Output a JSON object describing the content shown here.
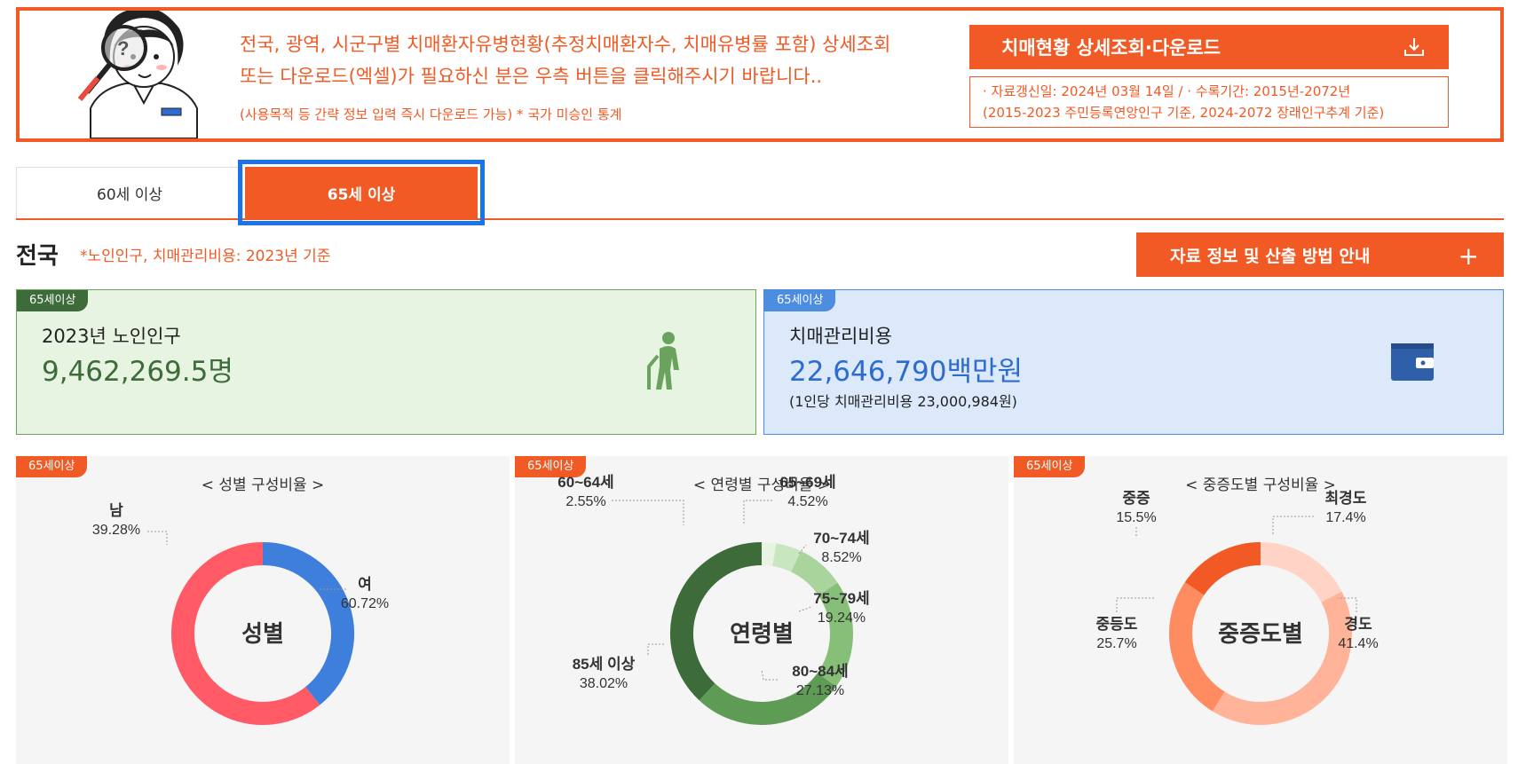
{
  "banner": {
    "line1": "전국, 광역, 시군구별 치매환자유병현황(추정치매환자수, 치매유병률 포함) 상세조회",
    "line2": "또는 다운로드(엑셀)가 필요하신 분은 우측 버튼을 클릭해주시기 바랍니다..",
    "sub": "(사용목적 등 간략 정보 입력 즉시 다운로드 가능) * 국가 미승인 통계",
    "download_label": "치매현황 상세조회·다운로드",
    "update_line1": "· 자료갱신일: 2024년 03월 14일 / · 수록기간: 2015년-2072년",
    "update_line2": "(2015-2023 주민등록연앙인구 기준, 2024-2072 장래인구추계 기준)"
  },
  "tabs": [
    {
      "label": "60세 이상",
      "active": false
    },
    {
      "label": "65세 이상",
      "active": true
    }
  ],
  "region": {
    "name": "전국",
    "note": "*노인인구, 치매관리비용: 2023년 기준",
    "info_button": "자료 정보 및 산출 방법 안내"
  },
  "cards": {
    "population": {
      "tag": "65세이상",
      "label": "2023년 노인인구",
      "value": "9,462,269.5명",
      "icon": "elderly-person-icon",
      "color": "#3d6b3a"
    },
    "cost": {
      "tag": "65세이상",
      "label": "치매관리비용",
      "value": "22,646,790백만원",
      "sub": "(1인당 치매관리비용 23,000,984원)",
      "icon": "wallet-icon",
      "color": "#2e6bd1"
    }
  },
  "panels": [
    {
      "tag": "65세이상",
      "title": "< 성별 구성비율 >",
      "center": "성별",
      "segments": [
        {
          "label": "남",
          "value": "39.28%",
          "pct": 39.28,
          "color": "#3f7fdc"
        },
        {
          "label": "여",
          "value": "60.72%",
          "pct": 60.72,
          "color": "#ff5a66"
        }
      ]
    },
    {
      "tag": "65세이상",
      "title": "< 연령별 구성비율 >",
      "center": "연령별",
      "segments": [
        {
          "label": "60~64세",
          "value": "2.55%",
          "pct": 2.55,
          "color": "#e6f4e1"
        },
        {
          "label": "65~69세",
          "value": "4.52%",
          "pct": 4.52,
          "color": "#c8e6bf"
        },
        {
          "label": "70~74세",
          "value": "8.52%",
          "pct": 8.52,
          "color": "#a9d49c"
        },
        {
          "label": "75~79세",
          "value": "19.24%",
          "pct": 19.24,
          "color": "#86bf77"
        },
        {
          "label": "80~84세",
          "value": "27.13%",
          "pct": 27.13,
          "color": "#5e9b54"
        },
        {
          "label": "85세 이상",
          "value": "38.02%",
          "pct": 38.02,
          "color": "#3d6b3a"
        }
      ]
    },
    {
      "tag": "65세이상",
      "title": "< 중증도별 구성비율 >",
      "center": "중증도별",
      "segments": [
        {
          "label": "최경도",
          "value": "17.4%",
          "pct": 17.4,
          "color": "#ffd4c6"
        },
        {
          "label": "경도",
          "value": "41.4%",
          "pct": 41.4,
          "color": "#ffb49a"
        },
        {
          "label": "중등도",
          "value": "25.7%",
          "pct": 25.7,
          "color": "#ff8c61"
        },
        {
          "label": "중증",
          "value": "15.5%",
          "pct": 15.5,
          "color": "#f15a24"
        }
      ]
    }
  ],
  "colors": {
    "accent": "#f15a24",
    "tab_focus": "#1a73e8"
  }
}
